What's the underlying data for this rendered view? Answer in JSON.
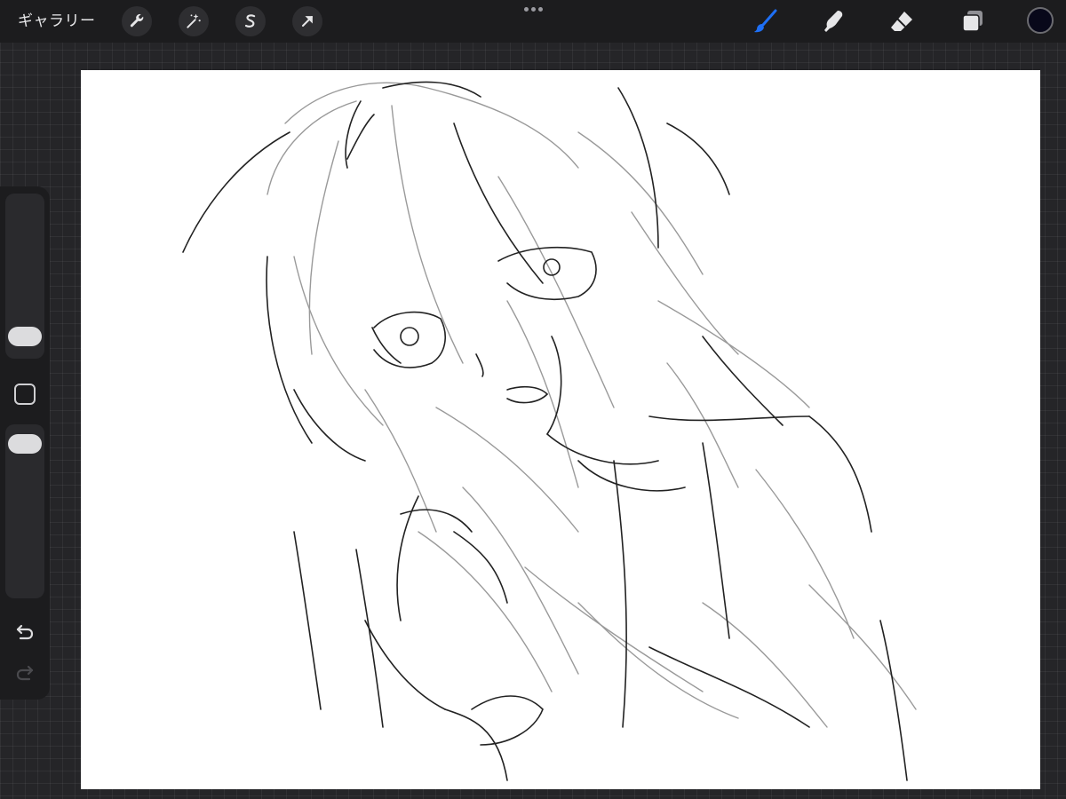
{
  "toolbar": {
    "gallery_label": "ギャラリー",
    "left_tools": [
      {
        "name": "actions",
        "icon": "wrench-icon"
      },
      {
        "name": "adjustments",
        "icon": "magic-wand-icon"
      },
      {
        "name": "selection",
        "icon": "selection-s-icon"
      },
      {
        "name": "transform",
        "icon": "arrow-cursor-icon"
      }
    ],
    "more_icon": "more-dots-icon",
    "right_tools": [
      {
        "name": "brush",
        "icon": "brush-icon",
        "active": true
      },
      {
        "name": "smudge",
        "icon": "smudge-finger-icon",
        "active": false
      },
      {
        "name": "eraser",
        "icon": "eraser-icon",
        "active": false
      },
      {
        "name": "layers",
        "icon": "layers-icon",
        "active": false
      }
    ],
    "current_color": "#08081a"
  },
  "sidebar": {
    "brush_size_slider": "size-slider",
    "modify_button": "square-icon",
    "opacity_slider": "opacity-slider",
    "undo_icon": "undo-icon",
    "redo_icon": "redo-icon",
    "redo_enabled": false
  },
  "colors": {
    "accent_active": "#1e6ff5",
    "toolbar_bg": "#1c1c1e",
    "workspace_bg": "#252528",
    "canvas_bg": "#ffffff"
  }
}
